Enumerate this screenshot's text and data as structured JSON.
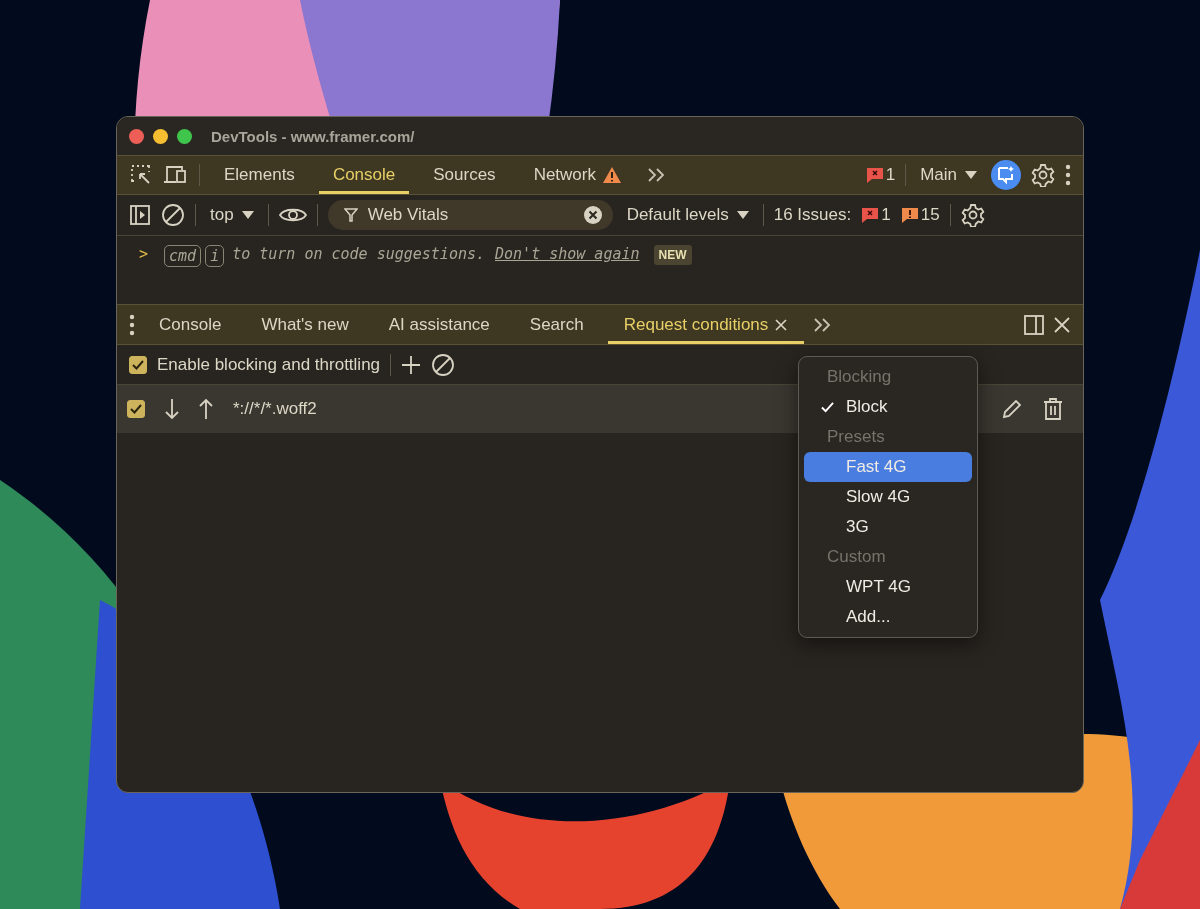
{
  "window": {
    "title": "DevTools - www.framer.com/"
  },
  "main_toolbar": {
    "tabs": [
      {
        "label": "Elements",
        "selected": false,
        "warning": false
      },
      {
        "label": "Console",
        "selected": true,
        "warning": false
      },
      {
        "label": "Sources",
        "selected": false,
        "warning": false
      },
      {
        "label": "Network",
        "selected": false,
        "warning": true
      }
    ],
    "error_count": "1",
    "target": "Main"
  },
  "console_toolbar": {
    "context": "top",
    "filter": {
      "value": "Web Vitals"
    },
    "levels": "Default levels",
    "issues_label": "16 Issues:",
    "issue_errors": "1",
    "issue_warnings": "15"
  },
  "console_hint": {
    "prompt": ">",
    "keys": [
      "cmd",
      "i"
    ],
    "text": "to turn on code suggestions.",
    "link": "Don't show again",
    "badge": "NEW"
  },
  "drawer": {
    "tabs": [
      {
        "label": "Console",
        "selected": false,
        "closable": false
      },
      {
        "label": "What's new",
        "selected": false,
        "closable": false
      },
      {
        "label": "AI assistance",
        "selected": false,
        "closable": false
      },
      {
        "label": "Search",
        "selected": false,
        "closable": false
      },
      {
        "label": "Request conditions",
        "selected": true,
        "closable": true
      }
    ],
    "enable": {
      "label": "Enable blocking and throttling",
      "checked": true
    },
    "rules": [
      {
        "checked": true,
        "pattern": "*://*/*.woff2"
      }
    ]
  },
  "menu": {
    "items": [
      {
        "kind": "header",
        "label": "Blocking"
      },
      {
        "kind": "option",
        "label": "Block",
        "checked": true,
        "highlighted": false
      },
      {
        "kind": "header",
        "label": "Presets"
      },
      {
        "kind": "option",
        "label": "Fast 4G",
        "checked": false,
        "highlighted": true
      },
      {
        "kind": "option",
        "label": "Slow 4G",
        "checked": false,
        "highlighted": false
      },
      {
        "kind": "option",
        "label": "3G",
        "checked": false,
        "highlighted": false
      },
      {
        "kind": "header",
        "label": "Custom"
      },
      {
        "kind": "option",
        "label": "WPT 4G",
        "checked": false,
        "highlighted": false
      },
      {
        "kind": "option",
        "label": "Add...",
        "checked": false,
        "highlighted": false
      }
    ]
  }
}
